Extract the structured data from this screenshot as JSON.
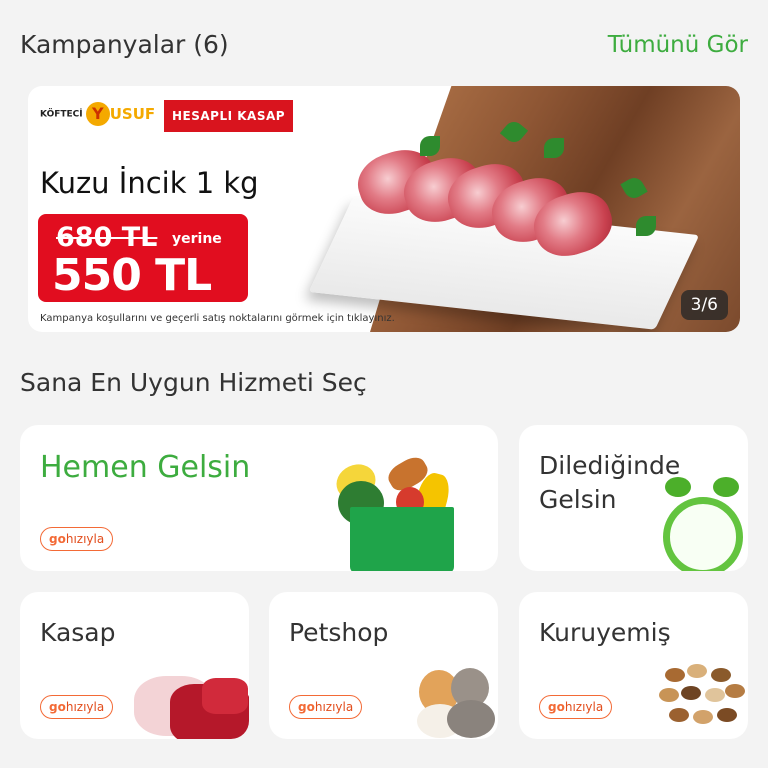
{
  "campaigns": {
    "title": "Kampanyalar (6)",
    "see_all": "Tümünü Gör",
    "banner": {
      "brand1_prefix": "KÖFTECİ",
      "brand1_mark": "Y",
      "brand1_name": "USUF",
      "brand2": "HESAPLI KASAP",
      "product": "Kuzu İncik 1 kg",
      "old_price": "680 TL",
      "instead": "yerine",
      "new_price": "550 TL",
      "disclaimer": "Kampanya koşullarını ve geçerli satış noktalarını görmek için tıklayınız.",
      "pager": "3/6"
    }
  },
  "services": {
    "title": "Sana En Uygun Hizmeti Seç",
    "cards": [
      {
        "label": "Hemen Gelsin",
        "badge_go": "go",
        "badge_text": "hızıyla",
        "icon": "grocery-bag"
      },
      {
        "label": "Dilediğinde Gelsin",
        "icon": "alarm-clock"
      },
      {
        "label": "Kasap",
        "badge_go": "go",
        "badge_text": "hızıyla",
        "icon": "meat"
      },
      {
        "label": "Petshop",
        "badge_go": "go",
        "badge_text": "hızıyla",
        "icon": "dog-cat"
      },
      {
        "label": "Kuruyemiş",
        "badge_go": "go",
        "badge_text": "hızıyla",
        "icon": "nuts"
      }
    ]
  },
  "colors": {
    "accent_green": "#3dac3f",
    "badge_orange": "#f36a36",
    "price_red": "#e10d1f"
  }
}
